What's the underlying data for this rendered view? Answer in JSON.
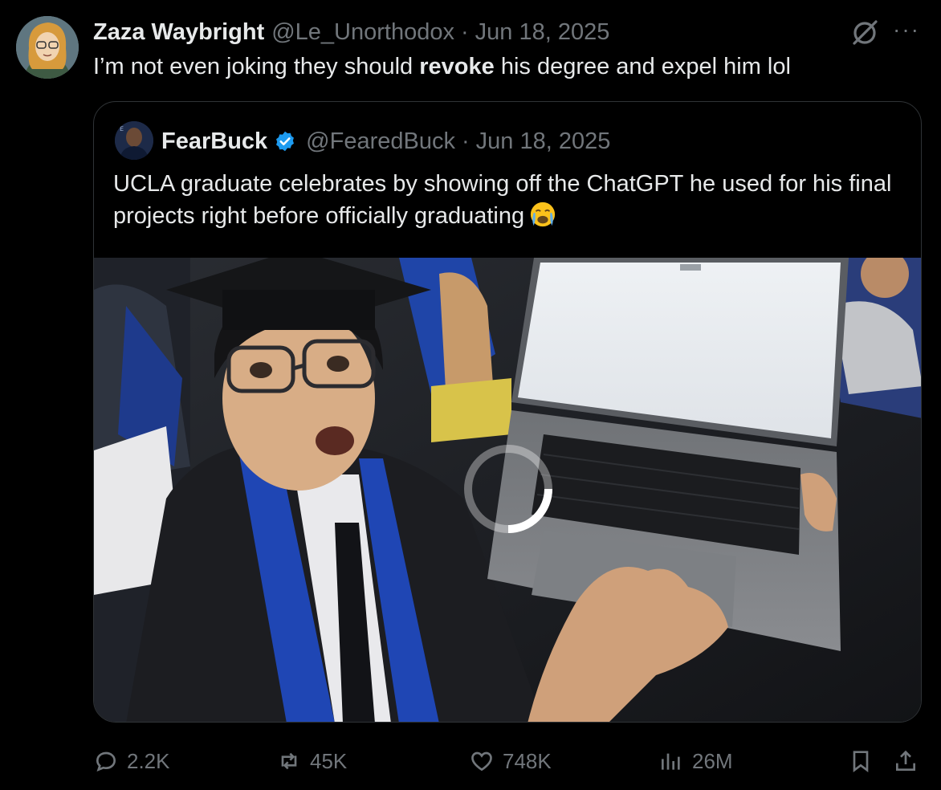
{
  "author": {
    "name": "Zaza Waybright",
    "handle": "@Le_Unorthodox",
    "separator": "·",
    "date": "Jun 18, 2025",
    "avatar_icon": "cartoon-avatar-icon"
  },
  "tweet": {
    "text_before": "I’m not even joking they should ",
    "text_bold": "revoke",
    "text_after": " his degree and expel him lol"
  },
  "quoted": {
    "name": "FearBuck",
    "verified": true,
    "handle": "@FearedBuck",
    "separator": "·",
    "date": "Jun 18, 2025",
    "text": "UCLA graduate celebrates by showing off the ChatGPT he used for his final projects right before officially graduating",
    "emoji": "crying-face-emoji",
    "media": {
      "type": "video",
      "loading": true,
      "description_icon": "graduate-with-laptop-photo"
    }
  },
  "actions": {
    "replies": "2.2K",
    "reposts": "45K",
    "likes": "748K",
    "views": "26M"
  },
  "colors": {
    "background": "#000000",
    "text_primary": "#e7e9ea",
    "text_secondary": "#71767b",
    "border": "#2f3336",
    "verified_blue": "#1d9bf0"
  }
}
